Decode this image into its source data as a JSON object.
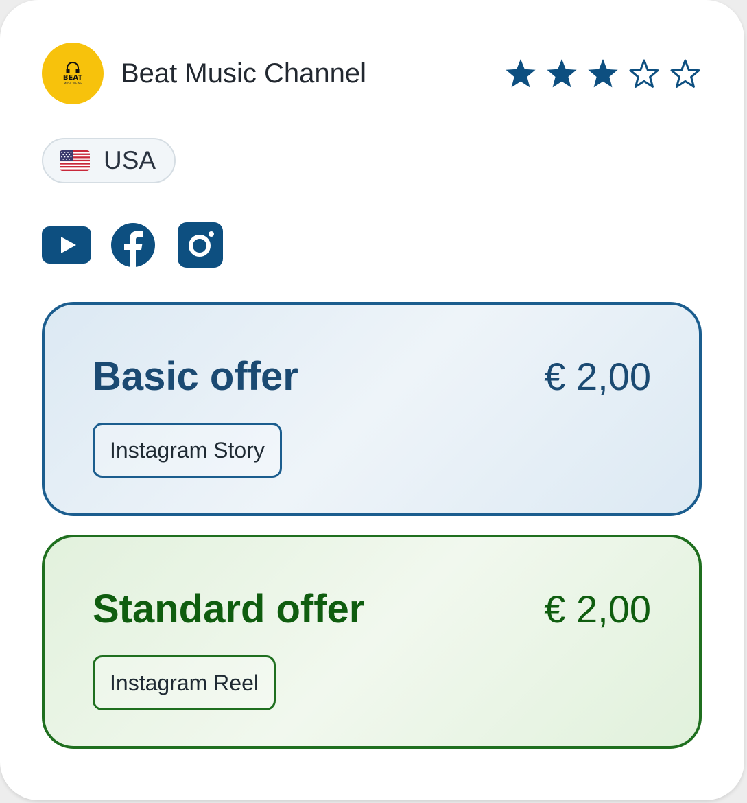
{
  "channel": {
    "logo_text": "BEAT",
    "logo_subtext": "MUSIC NEWS",
    "name": "Beat Music Channel",
    "rating": 3,
    "rating_max": 5,
    "logo_color": "#f7c20c",
    "star_color": "#0d4f80"
  },
  "country": {
    "flag_icon": "us-flag-icon",
    "name": "USA"
  },
  "socials": [
    {
      "icon": "youtube-icon"
    },
    {
      "icon": "facebook-icon"
    },
    {
      "icon": "instagram-icon"
    }
  ],
  "offers": [
    {
      "title": "Basic offer",
      "price": "€ 2,00",
      "tag": "Instagram Story",
      "accent": "#1b5d8e"
    },
    {
      "title": "Standard offer",
      "price": "€ 2,00",
      "tag": "Instagram Reel",
      "accent": "#1f6f1f"
    }
  ]
}
